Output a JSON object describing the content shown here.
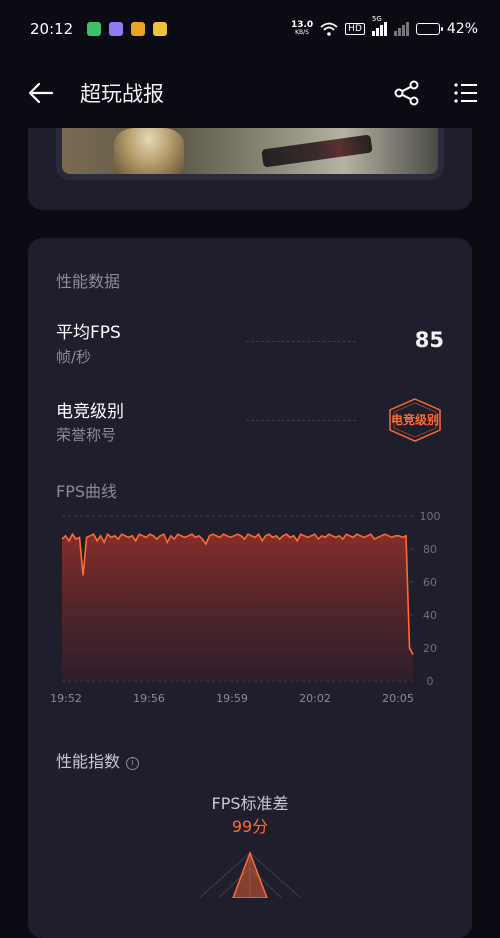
{
  "status_bar": {
    "time": "20:12",
    "net_speed_value": "13.0",
    "net_speed_unit": "KB/S",
    "hd_label": "HD",
    "network_5g": "5G",
    "battery_percent": "42%",
    "battery_level": 0.42
  },
  "header": {
    "title": "超玩战报",
    "back_icon": "arrow-left-icon",
    "share_icon": "share-icon",
    "menu_icon": "list-menu-icon"
  },
  "performance": {
    "section_title": "性能数据",
    "avg_fps_title": "平均FPS",
    "avg_fps_sub": "帧/秒",
    "avg_fps_value": "85",
    "rank_title": "电竞级别",
    "rank_sub": "荣誉称号",
    "rank_badge": "电竞级别",
    "accent_color": "#ff6a35"
  },
  "fps_curve": {
    "section_title": "FPS曲线"
  },
  "chart_data": {
    "type": "area",
    "x_tick_labels": [
      "19:52",
      "19:56",
      "19:59",
      "20:02",
      "20:05"
    ],
    "y_tick_labels": [
      "100",
      "80",
      "60",
      "40",
      "20",
      "0"
    ],
    "ylim": [
      0,
      100
    ],
    "grid": true,
    "values": [
      86,
      88,
      85,
      89,
      86,
      87,
      64,
      87,
      88,
      89,
      85,
      88,
      84,
      89,
      87,
      88,
      86,
      89,
      88,
      87,
      88,
      85,
      89,
      88,
      87,
      89,
      88,
      86,
      88,
      89,
      84,
      88,
      86,
      89,
      88,
      87,
      88,
      89,
      87,
      88,
      86,
      83,
      88,
      89,
      88,
      87,
      89,
      88,
      87,
      88,
      89,
      88,
      86,
      89,
      88,
      87,
      89,
      85,
      88,
      89,
      87,
      88,
      86,
      88,
      89,
      87,
      88,
      85,
      89,
      88,
      87,
      88,
      89,
      86,
      88,
      87,
      89,
      88,
      87,
      88,
      86,
      89,
      88,
      87,
      89,
      88,
      87,
      88,
      89,
      86,
      87,
      88,
      89,
      88,
      87,
      88,
      88,
      87,
      88,
      20,
      16
    ],
    "color": "#ff6a35"
  },
  "performance_index": {
    "section_title": "性能指数",
    "info_icon": "info-circle-icon",
    "std_label": "FPS标准差",
    "std_score": "99分"
  }
}
